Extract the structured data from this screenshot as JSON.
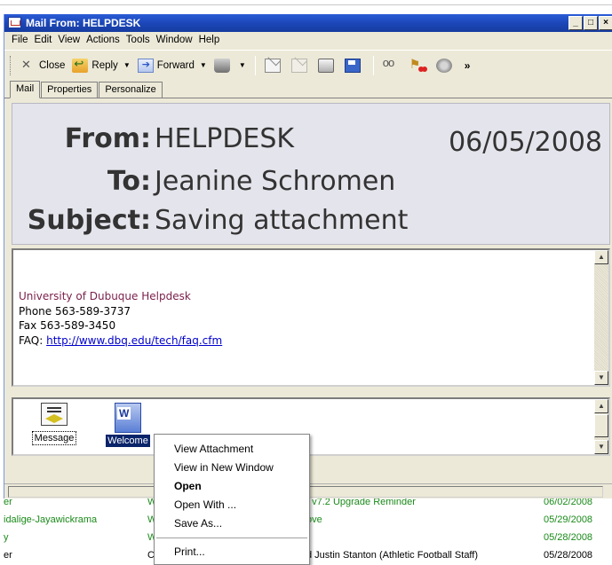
{
  "window": {
    "title": "Mail From: HELPDESK",
    "controls": {
      "minimize": "_",
      "maximize": "□",
      "close": "×"
    }
  },
  "menu": [
    "File",
    "Edit",
    "View",
    "Actions",
    "Tools",
    "Window",
    "Help"
  ],
  "toolbar": {
    "close_label": "Close",
    "reply_label": "Reply",
    "forward_label": "Forward",
    "more": "»"
  },
  "tabs": [
    "Mail",
    "Properties",
    "Personalize"
  ],
  "header": {
    "from_label": "From:",
    "from": "HELPDESK",
    "date": "06/05/2008",
    "to_label": "To:",
    "to": "Jeanine Schromen",
    "subject_label": "Subject:",
    "subject": "Saving attachment"
  },
  "body": {
    "org": "University of Dubuque Helpdesk",
    "phone": "Phone 563-589-3737",
    "fax": "Fax 563-589-3450",
    "faq_label": "FAQ: ",
    "faq_link": "http://www.dbq.edu/tech/faq.cfm"
  },
  "attachments": [
    {
      "name": "Message",
      "icon": "message-icon"
    },
    {
      "name": "Welcome",
      "icon": "word-document-icon"
    }
  ],
  "context_menu": {
    "items": [
      "View Attachment",
      "View in New Window",
      "Open",
      "Open With ...",
      "Save As...",
      "Print..."
    ]
  },
  "background_list": {
    "rows": [
      {
        "col1": "er",
        "col2": "W",
        "col3": ": v7.2 Upgrade Reminder",
        "date": "06/02/2008",
        "color": "green"
      },
      {
        "col1": "idalige-Jayawickrama",
        "col2": "W",
        "col3": "ove",
        "date": "05/29/2008",
        "color": "green"
      },
      {
        "col1": "y",
        "col2": "W",
        "col3": "",
        "date": "05/28/2008",
        "color": "green"
      },
      {
        "col1": "er",
        "col2": "C",
        "col3": "d Justin Stanton (Athletic Football Staff)",
        "date": "05/28/2008",
        "color": "black"
      }
    ]
  },
  "colors": {
    "titlebar": "#1c47b8",
    "header_bg": "#e4e4ec",
    "org_text": "#7a1f4a",
    "link": "#0000cc",
    "list_green": "#1a8a1a",
    "selection": "#0a246a"
  }
}
